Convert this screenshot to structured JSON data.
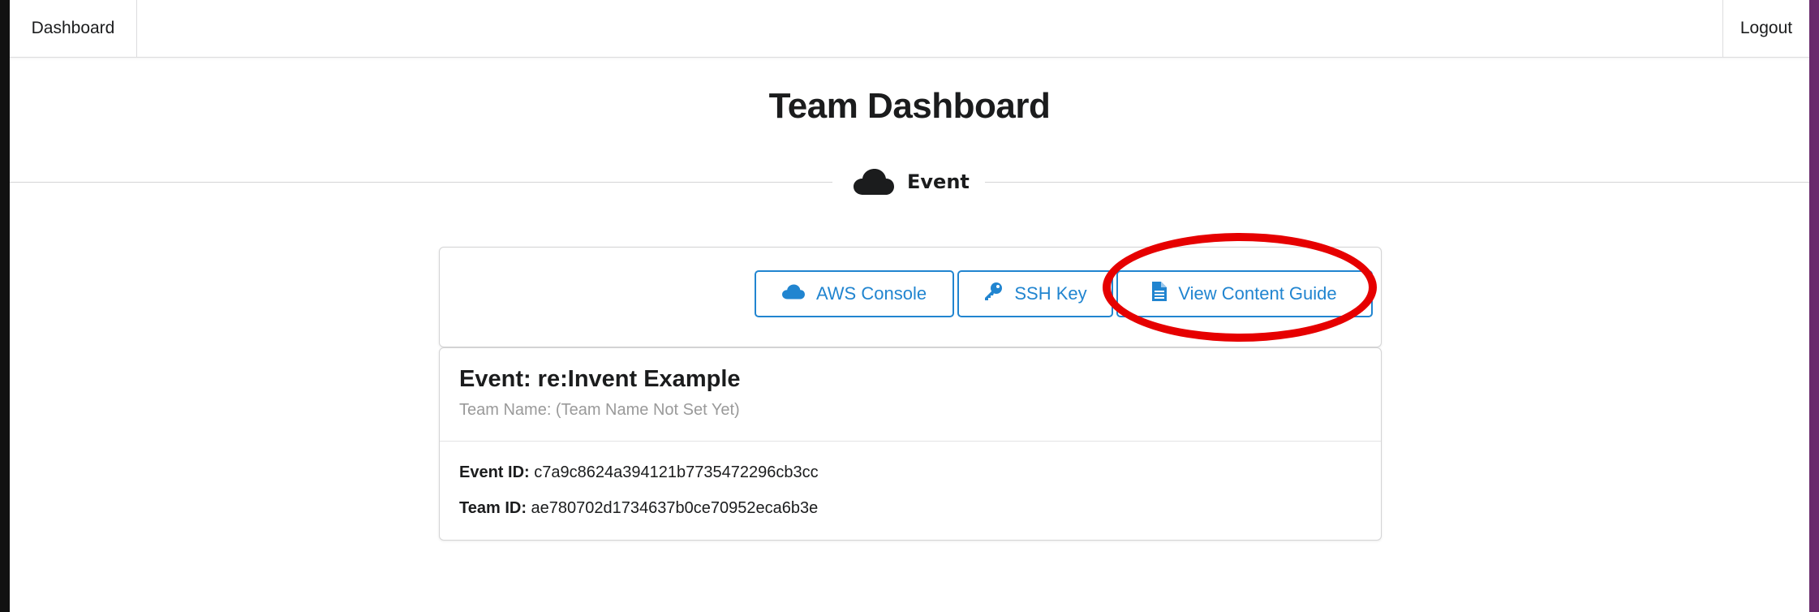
{
  "nav": {
    "left_label": "Dashboard",
    "right_label": "Logout"
  },
  "page_title": "Team Dashboard",
  "divider": {
    "label": "Event",
    "icon": "cloud-icon"
  },
  "buttons": [
    {
      "label": "AWS Console",
      "icon": "cloud-icon"
    },
    {
      "label": "SSH Key",
      "icon": "key-icon"
    },
    {
      "label": "View Content Guide",
      "icon": "file-icon"
    }
  ],
  "event": {
    "title": "Event: re:Invent Example",
    "team_name": "Team Name: (Team Name Not Set Yet)",
    "event_id_label": "Event ID:",
    "event_id_value": "c7a9c8624a394121b7735472296cb3cc",
    "team_id_label": "Team ID:",
    "team_id_value": "ae780702d1734637b0ce70952eca6b3e"
  },
  "colors": {
    "accent": "#2185d0",
    "highlight": "#e60000"
  }
}
